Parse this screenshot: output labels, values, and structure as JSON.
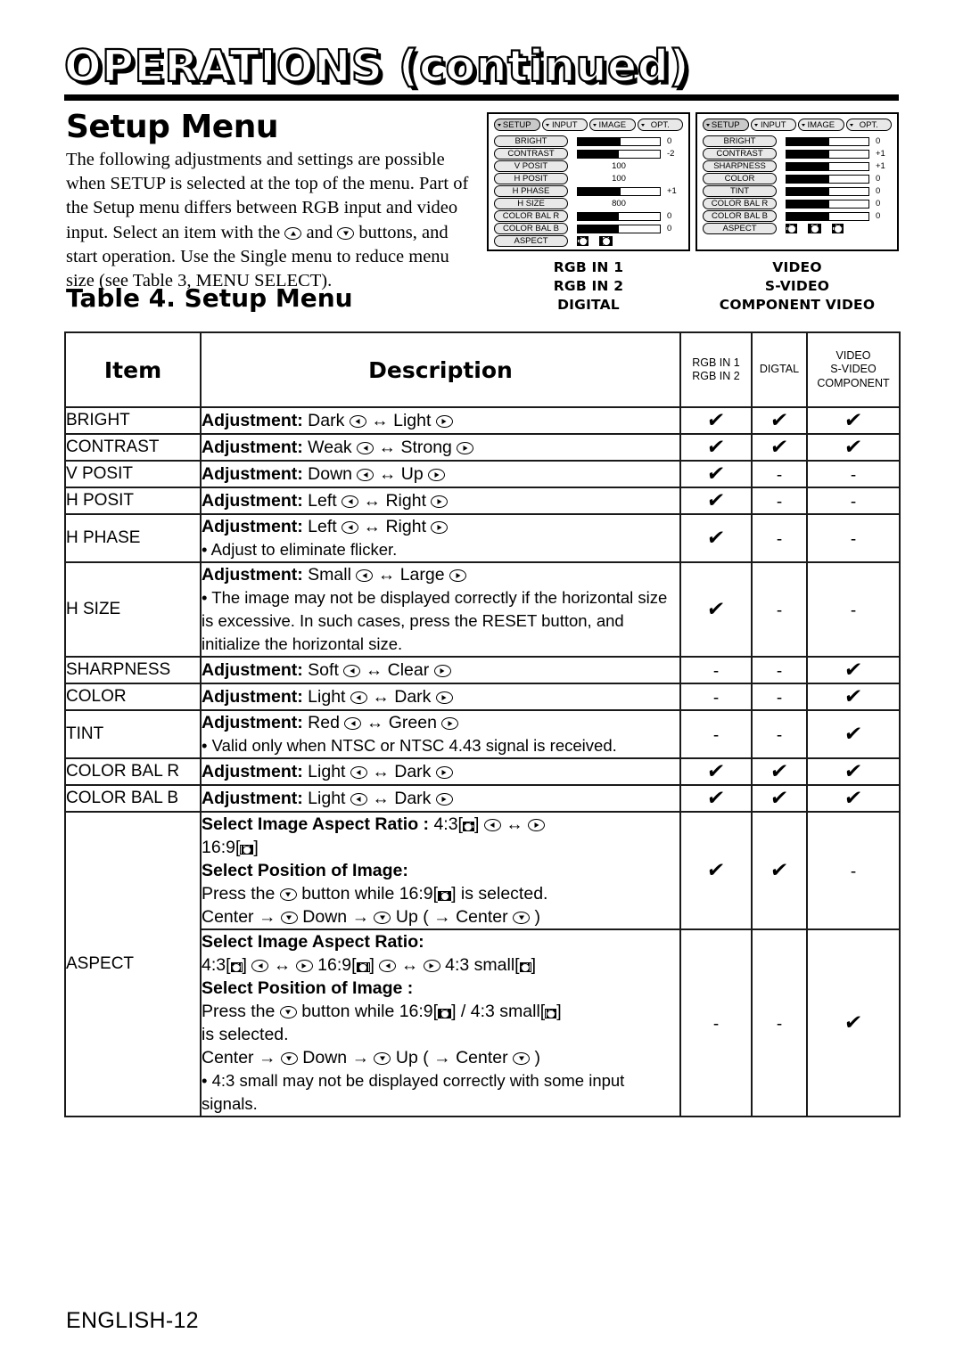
{
  "page": {
    "title": "OPERATIONS (continued)",
    "section_heading": "Setup Menu",
    "intro": "The following adjustments and settings are possible when SETUP is selected at the top of the menu. Part of the Setup menu differs between RGB input and video input. Select an item with the ▲ and ▼ buttons, and start operation. Use the Single menu to reduce menu size (see Table 3, MENU SELECT).",
    "table_caption": "Table 4. Setup Menu",
    "footer": "ENGLISH-12"
  },
  "osd_left": {
    "tabs": [
      {
        "label": "SETUP",
        "selected": true
      },
      {
        "label": "INPUT",
        "selected": false
      },
      {
        "label": "IMAGE",
        "selected": false
      },
      {
        "label": "OPT.",
        "selected": false
      }
    ],
    "rows": [
      {
        "label": "BRIGHT",
        "type": "bar",
        "fill_pct": 52,
        "value": "0"
      },
      {
        "label": "CONTRAST",
        "type": "bar",
        "fill_pct": 50,
        "value": "-2"
      },
      {
        "label": "V POSIT",
        "type": "num",
        "value": "100"
      },
      {
        "label": "H POSIT",
        "type": "num",
        "value": "100"
      },
      {
        "label": "H PHASE",
        "type": "bar",
        "fill_pct": 52,
        "value": "+1"
      },
      {
        "label": "H SIZE",
        "type": "num",
        "value": "800"
      },
      {
        "label": "COLOR BAL R",
        "type": "bar",
        "fill_pct": 50,
        "value": "0"
      },
      {
        "label": "COLOR BAL B",
        "type": "bar",
        "fill_pct": 50,
        "value": "0"
      },
      {
        "label": "ASPECT",
        "type": "icons",
        "icons": [
          "aspect-4-3-icon",
          "aspect-16-9-icon"
        ]
      }
    ]
  },
  "osd_right": {
    "tabs": [
      {
        "label": "SETUP",
        "selected": true
      },
      {
        "label": "INPUT",
        "selected": false
      },
      {
        "label": "IMAGE",
        "selected": false
      },
      {
        "label": "OPT.",
        "selected": false
      }
    ],
    "rows": [
      {
        "label": "BRIGHT",
        "type": "bar",
        "fill_pct": 52,
        "value": "0"
      },
      {
        "label": "CONTRAST",
        "type": "bar",
        "fill_pct": 52,
        "value": "+1"
      },
      {
        "label": "SHARPNESS",
        "type": "bar",
        "fill_pct": 52,
        "value": "+1"
      },
      {
        "label": "COLOR",
        "type": "bar",
        "fill_pct": 52,
        "value": "0"
      },
      {
        "label": "TINT",
        "type": "bar",
        "fill_pct": 52,
        "value": "0"
      },
      {
        "label": "COLOR BAL  R",
        "type": "bar",
        "fill_pct": 52,
        "value": "0"
      },
      {
        "label": "COLOR BAL  B",
        "type": "bar",
        "fill_pct": 52,
        "value": "0"
      },
      {
        "label": "ASPECT",
        "type": "icons",
        "icons": [
          "aspect-4-3-icon",
          "aspect-16-9-icon",
          "aspect-4-3-small-icon"
        ]
      }
    ]
  },
  "captions": {
    "left": "RGB IN 1\nRGB IN 2\nDIGITAL",
    "right": "VIDEO\nS-VIDEO\nCOMPONENT VIDEO"
  },
  "table": {
    "headers": {
      "item": "Item",
      "description": "Description",
      "rgb": "RGB IN 1\nRGB IN 2",
      "digital": "DIGTAL",
      "video": "VIDEO\nS-VIDEO\nCOMPONENT"
    },
    "rows": [
      {
        "item": "BRIGHT",
        "adjustment_label": "Adjustment:",
        "low": "Dark",
        "high": "Light",
        "rgb": "check",
        "digital": "check",
        "video": "check"
      },
      {
        "item": "CONTRAST",
        "adjustment_label": "Adjustment:",
        "low": "Weak",
        "high": "Strong",
        "rgb": "check",
        "digital": "check",
        "video": "check"
      },
      {
        "item": "V POSIT",
        "adjustment_label": "Adjustment:",
        "low": "Down",
        "high": "Up",
        "rgb": "check",
        "digital": "dash",
        "video": "dash"
      },
      {
        "item": "H POSIT",
        "adjustment_label": "Adjustment:",
        "low": "Left",
        "high": "Right",
        "rgb": "check",
        "digital": "dash",
        "video": "dash"
      },
      {
        "item": "H PHASE",
        "adjustment_label": "Adjustment:",
        "low": "Left",
        "high": "Right",
        "note": "• Adjust to eliminate flicker.",
        "rgb": "check",
        "digital": "dash",
        "video": "dash"
      },
      {
        "item": "H SIZE",
        "adjustment_label": "Adjustment:",
        "low": "Small",
        "high": "Large",
        "note": "• The image may not be displayed correctly if the horizontal size is excessive. In such cases, press the RESET button, and initialize the horizontal size.",
        "rgb": "check",
        "digital": "dash",
        "video": "dash"
      },
      {
        "item": "SHARPNESS",
        "adjustment_label": "Adjustment:",
        "low": "Soft",
        "high": "Clear",
        "rgb": "dash",
        "digital": "dash",
        "video": "check"
      },
      {
        "item": "COLOR",
        "adjustment_label": "Adjustment:",
        "low": "Light",
        "high": "Dark",
        "rgb": "dash",
        "digital": "dash",
        "video": "check"
      },
      {
        "item": "TINT",
        "adjustment_label": "Adjustment:",
        "low": "Red",
        "high": "Green",
        "note": "• Valid only when NTSC or NTSC 4.43 signal is received.",
        "rgb": "dash",
        "digital": "dash",
        "video": "check"
      },
      {
        "item": "COLOR BAL R",
        "adjustment_label": "Adjustment:",
        "low": "Light",
        "high": "Dark",
        "rgb": "check",
        "digital": "check",
        "video": "check"
      },
      {
        "item": "COLOR BAL B",
        "adjustment_label": "Adjustment:",
        "low": "Light",
        "high": "Dark",
        "rgb": "check",
        "digital": "check",
        "video": "check"
      }
    ],
    "aspect": {
      "item": "ASPECT",
      "block_rgb": {
        "ratio_heading": "Select Image Aspect Ratio :",
        "ratio_line_a": "4:3[",
        "ratio_line_a_tail": "]",
        "ratio_line_b_prefix": "16:9[",
        "ratio_line_b_tail": "]",
        "position_heading": "Select Position of Image:",
        "press_prefix": "Press the",
        "press_mid": "button while 16:9[",
        "press_tail": "] is selected.",
        "cycle": "Center →",
        "cycle_mid": "Down →",
        "cycle_mid2": "Up ( → Center",
        "cycle_tail": ")",
        "rgb": "check",
        "digital": "check",
        "video": "dash"
      },
      "block_video": {
        "ratio_heading": "Select Image Aspect Ratio:",
        "ratio_43": "4:3[",
        "ratio_169": "16:9[",
        "ratio_43small": "4:3 small[",
        "bracket": "]",
        "position_heading": "Select Position of Image :",
        "press_prefix": "Press the",
        "press_mid": "button while 16:9[",
        "press_mid2": "] / 4:3 small[",
        "press_tail": "]",
        "press_line2": "is selected.",
        "cycle": "Center →",
        "cycle_mid": "Down →",
        "cycle_mid2": "Up ( → Center",
        "cycle_tail": ")",
        "note": "• 4:3 small may not be displayed correctly with some input signals.",
        "rgb": "dash",
        "digital": "dash",
        "video": "check"
      }
    }
  },
  "symbols": {
    "check": "✔",
    "dash": "-",
    "swap": "↔"
  }
}
